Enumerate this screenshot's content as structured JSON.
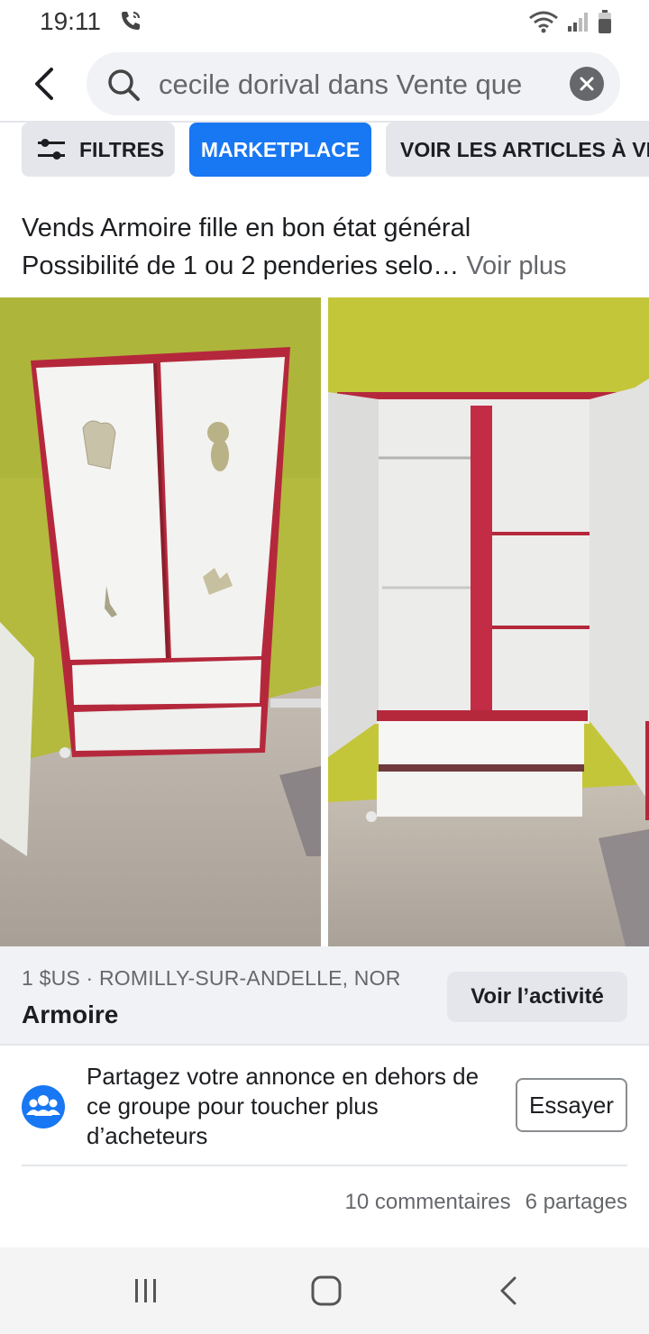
{
  "status_bar": {
    "time": "19:11"
  },
  "search": {
    "query": "cecile dorival dans Vente que"
  },
  "chips": {
    "filters": "FILTRES",
    "marketplace": "MARKETPLACE",
    "voir_articles": "VOIR LES ARTICLES À VE"
  },
  "post": {
    "line1": "Vends Armoire fille en bon état général",
    "line2": "Possibilité de 1 ou 2 penderies selo…",
    "see_more": "Voir plus"
  },
  "listing": {
    "price_location": "1 $US · ROMILLY-SUR-ANDELLE, NOR",
    "title": "Armoire",
    "activity_button": "Voir l’activité"
  },
  "share_prompt": {
    "text": "Partagez votre annonce en dehors de ce groupe pour toucher plus d’acheteurs",
    "button": "Essayer"
  },
  "engagement": {
    "comments": "10 commentaires",
    "shares": "6 partages"
  },
  "colors": {
    "accent": "#1877f2",
    "wall": "#b7bd3c",
    "wardrobe_trim": "#b5283c"
  }
}
